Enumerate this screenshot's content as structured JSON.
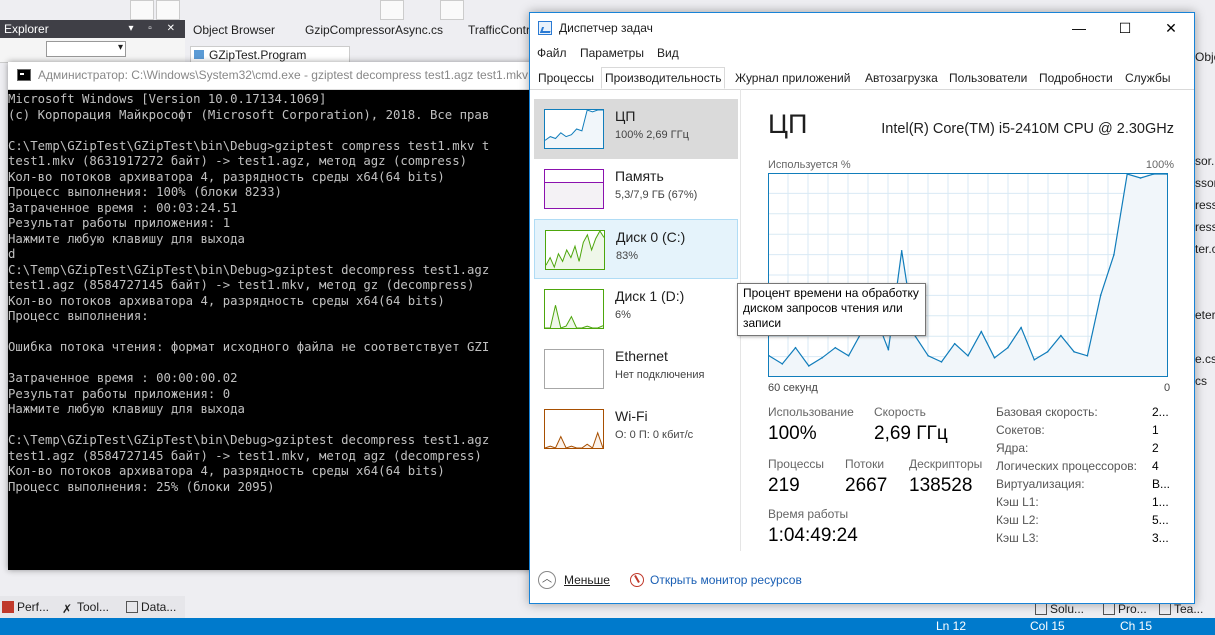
{
  "vs": {
    "explorer_title": "Explorer",
    "doc_tabs": [
      "Object Browser",
      "GzipCompressorAsync.cs",
      "TrafficContr"
    ],
    "breadcrumb": "GZipTest.Program",
    "right_top": "Objec",
    "right_list": [
      "sor.",
      "ssorA",
      "resso",
      "resso",
      "ter.cs",
      "",
      "",
      "eters",
      "",
      "e.cs",
      "cs"
    ],
    "bottom_tabs": [
      "Perf...",
      "Tool...",
      "Data..."
    ],
    "right_tabs": [
      "Solu...",
      "Pro...",
      "Tea..."
    ],
    "status": [
      "Ln 12",
      "Col 15",
      "Ch 15"
    ]
  },
  "cmd": {
    "title": "Администратор: C:\\Windows\\System32\\cmd.exe - gziptest  decompress test1.agz test1.mkv",
    "lines": [
      "Microsoft Windows [Version 10.0.17134.1069]",
      "(c) Корпорация Майкрософт (Microsoft Corporation), 2018. Все прав",
      "",
      "C:\\Temp\\GZipTest\\GZipTest\\bin\\Debug>gziptest compress test1.mkv t",
      "test1.mkv (8631917272 байт) -> test1.agz, метод agz (compress)",
      "Кол-во потоков архиватора 4, разрядность среды x64(64 bits)",
      "Процесс выполнения: 100% (блоки 8233)",
      "Затраченное время : 00:03:24.51",
      "Результат работы приложения: 1",
      "Нажмите любую клавишу для выхода",
      "d",
      "C:\\Temp\\GZipTest\\GZipTest\\bin\\Debug>gziptest decompress test1.agz",
      "test1.agz (8584727145 байт) -> test1.mkv, метод gz (decompress)",
      "Кол-во потоков архиватора 4, разрядность среды x64(64 bits)",
      "Процесс выполнения:",
      "",
      "Ошибка потока чтения: формат исходного файла не соответствует GZI",
      "",
      "Затраченное время : 00:00:00.02",
      "Результат работы приложения: 0",
      "Нажмите любую клавишу для выхода",
      "",
      "C:\\Temp\\GZipTest\\GZipTest\\bin\\Debug>gziptest decompress test1.agz",
      "test1.agz (8584727145 байт) -> test1.mkv, метод agz (decompress)",
      "Кол-во потоков архиватора 4, разрядность среды x64(64 bits)",
      "Процесс выполнения: 25% (блоки 2095)"
    ]
  },
  "tm": {
    "title": "Диспетчер задач",
    "window_buttons": [
      "—",
      "☐",
      "✕"
    ],
    "menu": [
      "Файл",
      "Параметры",
      "Вид"
    ],
    "tabs": [
      "Процессы",
      "Производительность",
      "Журнал приложений",
      "Автозагрузка",
      "Пользователи",
      "Подробности",
      "Службы"
    ],
    "active_tab": "Производительность",
    "resources": [
      {
        "name": "ЦП",
        "value": "100% 2,69 ГГц",
        "color": "#117dbb",
        "fill": "#f1f6fa",
        "levels": [
          0.2,
          0.3,
          0.25,
          0.4,
          0.3,
          0.35,
          0.5,
          0.45,
          1,
          0.95,
          1,
          1
        ]
      },
      {
        "name": "Память",
        "value": "5,3/7,9 ГБ (67%)",
        "color": "#8b12ae",
        "fill": "#f4f2f5",
        "levels": [
          0.67,
          0.67,
          0.67,
          0.67,
          0.67,
          0.67,
          0.67,
          0.67
        ]
      },
      {
        "name": "Диск 0 (C:)",
        "value": "83%",
        "color": "#4da60c",
        "fill": "#eff7e9",
        "levels": [
          0.1,
          0.3,
          0.05,
          0.4,
          0.2,
          0.5,
          0.3,
          0.6,
          0.2,
          0.7,
          0.9,
          0.5,
          0.8,
          1,
          0.83
        ]
      },
      {
        "name": "Диск 1 (D:)",
        "value": "6%",
        "color": "#4da60c",
        "fill": "#eff7e9",
        "levels": [
          0,
          0,
          0.6,
          0,
          0.05,
          0.3,
          0,
          0,
          0.05,
          0,
          0,
          0.06
        ]
      },
      {
        "name": "Ethernet",
        "value": "Нет подключения",
        "color": "#a7a7a7",
        "fill": "#f2f2f2",
        "levels": []
      },
      {
        "name": "Wi-Fi",
        "value": "О: 0 П: 0 кбит/с",
        "color": "#a74f01",
        "fill": "#fcf3eb",
        "levels": [
          0,
          0.05,
          0,
          0.3,
          0,
          0.05,
          0,
          0,
          0.1,
          0,
          0.4,
          0
        ]
      }
    ],
    "cpu": {
      "heading": "ЦП",
      "model": "Intel(R) Core(TM) i5-2410M CPU @ 2.30GHz",
      "graph_label": "Используется %",
      "graph_max": "100%",
      "graph_x_left": "60 секунд",
      "graph_x_right": "0",
      "utilization_label": "Использование",
      "utilization": "100%",
      "speed_label": "Скорость",
      "speed": "2,69 ГГц",
      "processes_label": "Процессы",
      "processes": "219",
      "threads_label": "Потоки",
      "threads": "2667",
      "handles_label": "Дескрипторы",
      "handles": "138528",
      "uptime_label": "Время работы",
      "uptime": "1:04:49:24",
      "specs": [
        {
          "label": "Базовая скорость:",
          "value": "2..."
        },
        {
          "label": "Сокетов:",
          "value": "1"
        },
        {
          "label": "Ядра:",
          "value": "2"
        },
        {
          "label": "Логических процессоров:",
          "value": "4"
        },
        {
          "label": "Виртуализация:",
          "value": "В..."
        },
        {
          "label": "Кэш L1:",
          "value": "1..."
        },
        {
          "label": "Кэш L2:",
          "value": "5..."
        },
        {
          "label": "Кэш L3:",
          "value": "3..."
        }
      ]
    },
    "chart_data": {
      "type": "area",
      "x": [
        60,
        58,
        56,
        54,
        52,
        50,
        48,
        46,
        44,
        42,
        40,
        38,
        36,
        34,
        32,
        30,
        28,
        26,
        24,
        22,
        20,
        18,
        16,
        14,
        12,
        10,
        8,
        6,
        4,
        2,
        0
      ],
      "values": [
        10,
        6,
        14,
        5,
        9,
        14,
        10,
        22,
        30,
        13,
        62,
        20,
        10,
        7,
        16,
        10,
        22,
        9,
        14,
        24,
        8,
        12,
        20,
        12,
        10,
        40,
        60,
        100,
        98,
        100,
        100
      ],
      "ylim": [
        0,
        100
      ],
      "line_color": "#117dbb",
      "fill_color": "#f1f6fa"
    },
    "footer": {
      "fewer": "Меньше",
      "resource_monitor": "Открыть монитор ресурсов"
    }
  },
  "tooltip": {
    "text": "Процент времени на обработку диском запросов чтения или записи"
  }
}
